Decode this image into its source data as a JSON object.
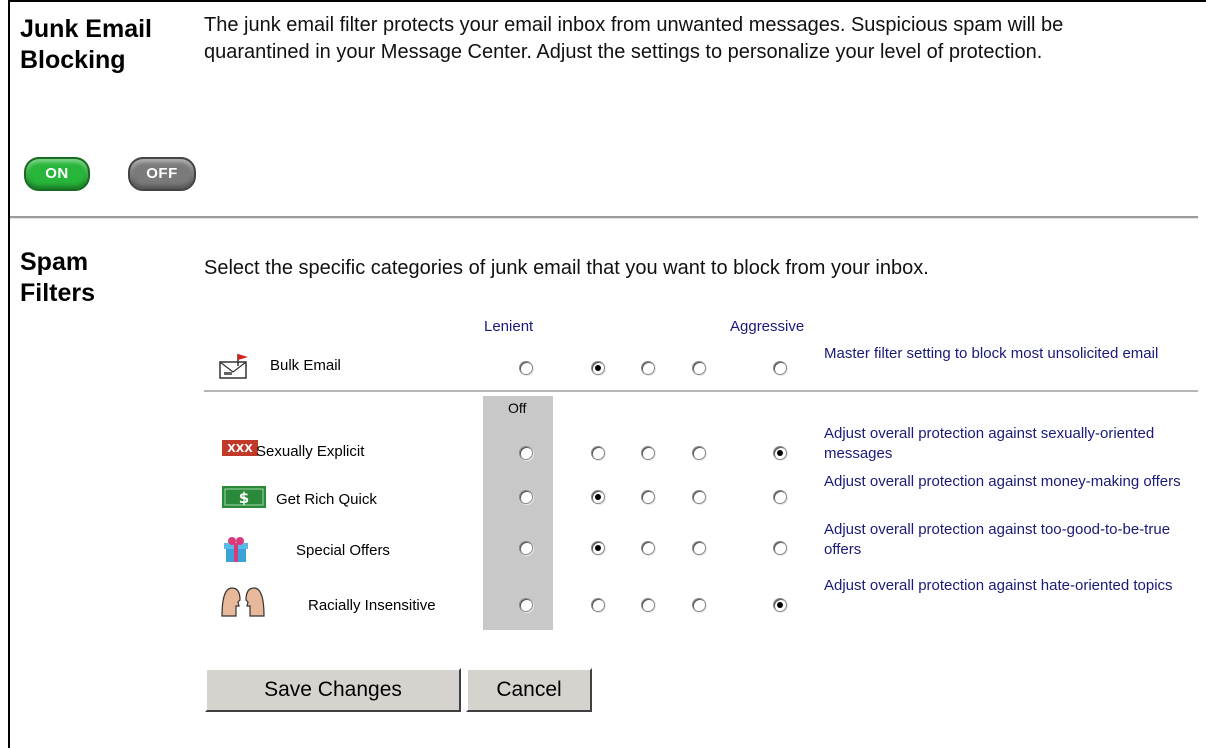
{
  "junk": {
    "title_line1": "Junk Email",
    "title_line2": "Blocking",
    "description": "The junk email filter protects your email inbox from unwanted messages. Suspicious spam will be quarantined in your Message Center. Adjust the settings to personalize your level of protection.",
    "on_label": "ON",
    "off_label": "OFF"
  },
  "spam": {
    "title_line1": "Spam",
    "title_line2": "Filters",
    "description": "Select the specific categories of junk email that you want to block from your inbox.",
    "lenient_label": "Lenient",
    "aggressive_label": "Aggressive",
    "off_column_label": "Off",
    "bulk": {
      "label": "Bulk Email",
      "icon": "envelope-flag-icon",
      "description": "Master filter setting to block most unsolicited email",
      "selected_level": 2
    },
    "categories": [
      {
        "label": "Sexually Explicit",
        "icon": "xxx-icon",
        "description": "Adjust overall protection against sexually-oriented messages",
        "selected_level": 5
      },
      {
        "label": "Get Rich Quick",
        "icon": "dollar-icon",
        "description": "Adjust overall protection against money-making offers",
        "selected_level": 2
      },
      {
        "label": "Special Offers",
        "icon": "gift-icon",
        "description": "Adjust overall protection against too-good-to-be-true offers",
        "selected_level": 2
      },
      {
        "label": "Racially Insensitive",
        "icon": "faces-icon",
        "description": "Adjust overall protection against hate-oriented topics",
        "selected_level": 5
      }
    ]
  },
  "buttons": {
    "save_label": "Save Changes",
    "cancel_label": "Cancel"
  },
  "colors": {
    "on_green": "#27b53a",
    "off_gray": "#7a7a7a",
    "link_navy": "#1a1a7a"
  }
}
